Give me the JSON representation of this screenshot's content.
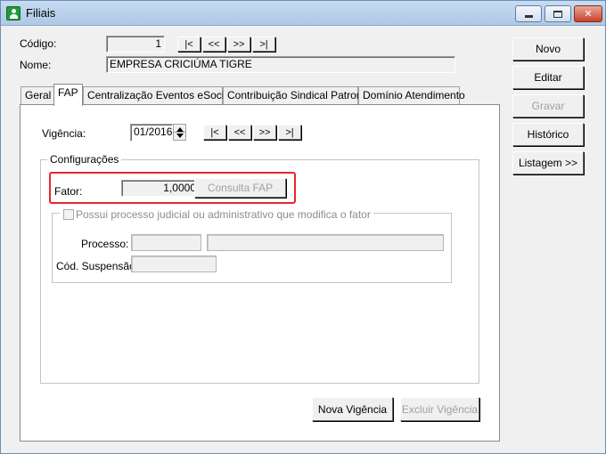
{
  "window": {
    "title": "Filiais"
  },
  "header": {
    "codigo_label": "Código:",
    "codigo_value": "1",
    "nome_label": "Nome:",
    "nome_value": "EMPRESA CRICIÚMA TIGRE",
    "nav": [
      "|<",
      "<<",
      ">>",
      ">|"
    ]
  },
  "tabs": [
    {
      "label": "Geral",
      "active": false
    },
    {
      "label": "FAP",
      "active": true
    },
    {
      "label": "Centralização Eventos eSocial",
      "active": false
    },
    {
      "label": "Contribuição Sindical Patronal",
      "active": false
    },
    {
      "label": "Domínio Atendimento",
      "active": false
    }
  ],
  "fap": {
    "vigencia_label": "Vigência:",
    "vigencia_value": "01/2016",
    "nav": [
      "|<",
      "<<",
      ">>",
      ">|"
    ],
    "config_title": "Configurações",
    "fator_label": "Fator:",
    "fator_value": "1,0000",
    "consulta_button": "Consulta FAP",
    "processo_checkbox_label": "Possui processo judicial ou administrativo que modifica o fator",
    "processo_label": "Processo:",
    "processo_value": "",
    "processo_desc_value": "",
    "suspensao_label": "Cód. Suspensão:",
    "suspensao_value": "",
    "nova_vigencia_button": "Nova Vigência",
    "excluir_vigencia_button": "Excluir Vigência"
  },
  "actions": {
    "novo": "Novo",
    "editar": "Editar",
    "gravar": "Gravar",
    "historico": "Histórico",
    "listagem": "Listagem >>"
  },
  "colors": {
    "highlight": "#e8262c",
    "app_icon": "#1d9b3a"
  }
}
